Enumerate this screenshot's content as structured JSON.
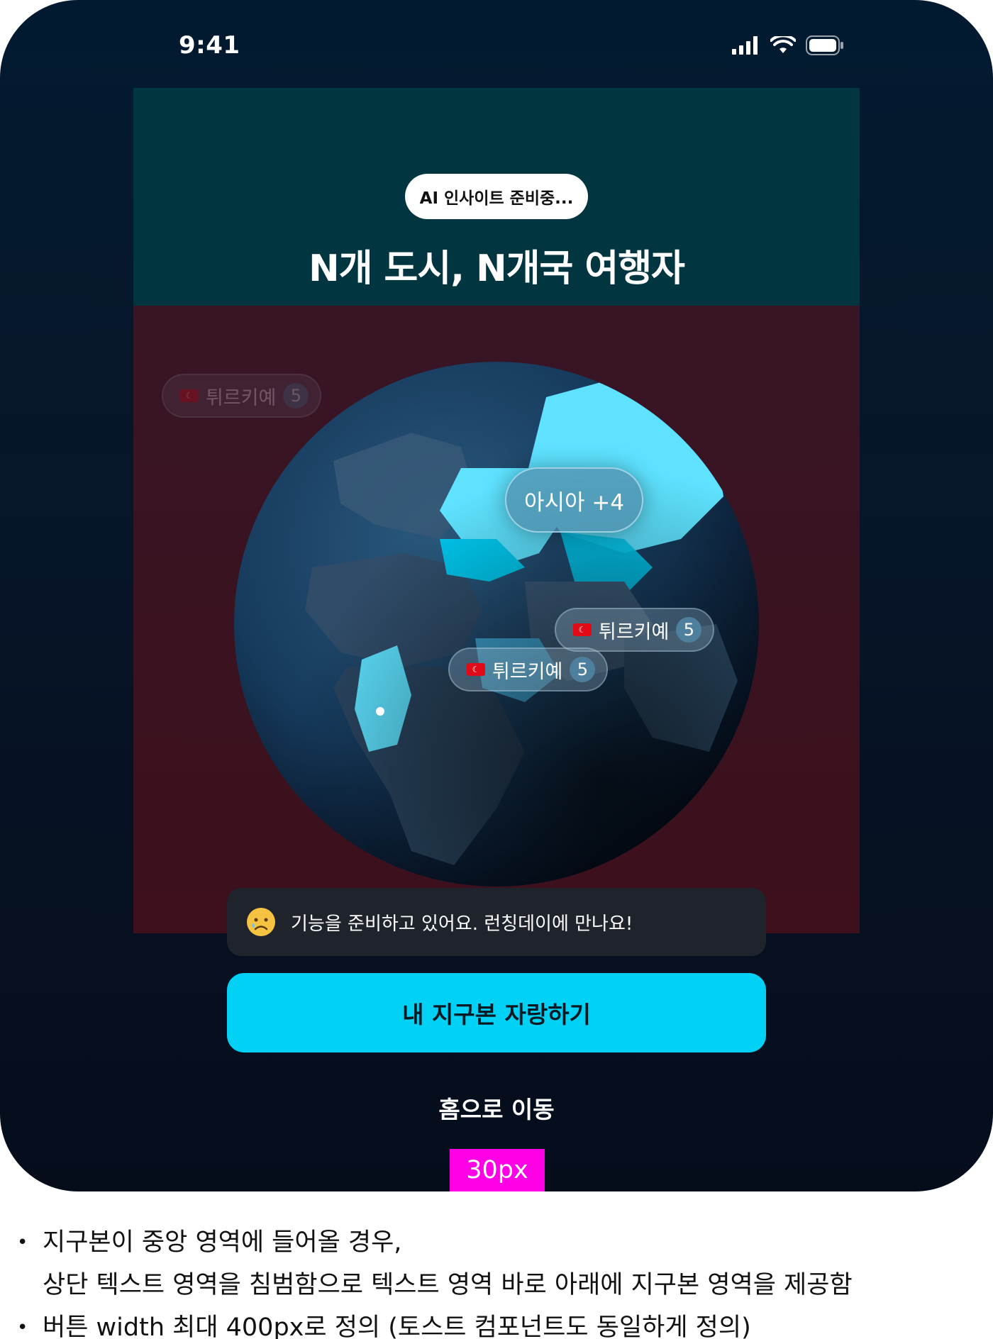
{
  "status_bar": {
    "time": "9:41"
  },
  "header": {
    "pill_label": "AI 인사이트 준비중...",
    "headline": "N개 도시, N개국 여행자"
  },
  "globe": {
    "cluster_label": "아시아 +4",
    "chips": [
      {
        "country": "튀르키예",
        "count": "5",
        "state": "faded"
      },
      {
        "country": "튀르키예",
        "count": "5",
        "state": "active"
      },
      {
        "country": "튀르키예",
        "count": "5",
        "state": "active"
      }
    ],
    "highlight_colors": {
      "primary": "#5ee2ff",
      "secondary": "#00c8ee"
    }
  },
  "toast": {
    "message": "기능을 준비하고 있어요. 런칭데이에 만나요!",
    "icon": "sad-face-emoji"
  },
  "actions": {
    "primary_label": "내 지구본 자랑하기",
    "secondary_label": "홈으로 이동"
  },
  "annotation": {
    "spacing_label": "30px"
  },
  "notes": [
    "지구본이 중앙 영역에 들어올 경우,",
    "상단 텍스트 영역을 침범함으로 텍스트 영역 바로 아래에 지구본 영역을 제공함",
    "버튼 width 최대 400px로 정의 (토스트 컴포넌트도 동일하게 정의)"
  ],
  "colors": {
    "accent": "#00d1f5",
    "top_band": "#013540",
    "globe_band": "#3d101c",
    "measure": "#ff00e6"
  }
}
